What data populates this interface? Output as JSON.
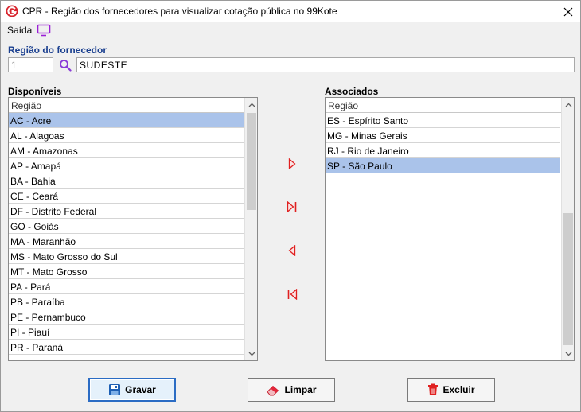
{
  "window": {
    "title": "CPR - Região dos fornecedores para visualizar cotação pública no 99Kote"
  },
  "menu": {
    "saida_label": "Saída",
    "saida_icon": "monitor-icon"
  },
  "region_filter": {
    "label": "Região do fornecedor",
    "code_value": "1",
    "name_value": "SUDESTE"
  },
  "available": {
    "label": "Disponíveis",
    "column_header": "Região",
    "items": [
      "AC - Acre",
      "AL - Alagoas",
      "AM - Amazonas",
      "AP - Amapá",
      "BA - Bahia",
      "CE - Ceará",
      "DF - Distrito Federal",
      "GO - Goiás",
      "MA - Maranhão",
      "MS - Mato Grosso do Sul",
      "MT - Mato Grosso",
      "PA - Pará",
      "PB - Paraíba",
      "PE - Pernambuco",
      "PI - Piauí",
      "PR - Paraná"
    ],
    "selected_index": 0
  },
  "associated": {
    "label": "Associados",
    "column_header": "Região",
    "items": [
      "ES - Espírito Santo",
      "MG - Minas Gerais",
      "RJ - Rio de Janeiro",
      "SP - São Paulo"
    ],
    "selected_index": 3
  },
  "transfer_buttons": {
    "move_one_right": "chevron-right-icon",
    "move_all_right": "move-all-right-icon",
    "move_one_left": "chevron-left-icon",
    "move_all_left": "move-all-left-icon"
  },
  "actions": {
    "save_label": "Gravar",
    "clear_label": "Limpar",
    "delete_label": "Excluir"
  },
  "colors": {
    "section_label": "#1a3f8f",
    "selection": "#aac3ea",
    "transfer_arrow": "#e02020",
    "app_icon": "#d8252e",
    "monitor_icon": "#9b1fd6",
    "lookup_icon": "#8a3bd8"
  }
}
